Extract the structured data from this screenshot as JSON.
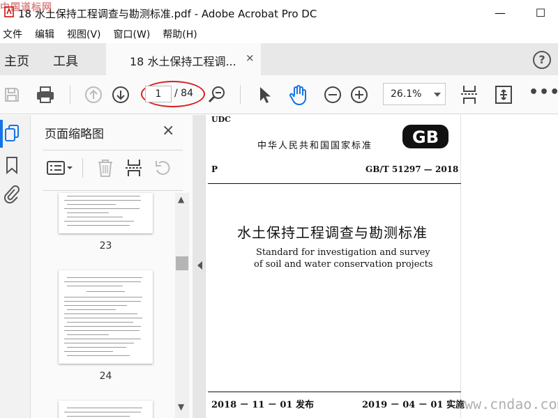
{
  "window": {
    "title": "18 水土保持工程调查与勘测标准.pdf - Adobe Acrobat Pro DC",
    "watermark_top": "中国道标网",
    "minimize_glyph": "—",
    "maximize_glyph": "☐"
  },
  "menu": [
    "文件",
    "编辑",
    "视图(V)",
    "窗口(W)",
    "帮助(H)"
  ],
  "tabs": {
    "home": "主页",
    "tools": "工具",
    "document": "18 水土保持工程调...",
    "close": "×",
    "help": "?"
  },
  "toolbar": {
    "icons": [
      "save-icon",
      "print-icon",
      "prev-page-icon",
      "next-page-icon",
      "zoom-search-icon",
      "select-arrow-icon",
      "hand-icon",
      "zoom-out-icon",
      "zoom-in-icon",
      "fit-width-icon",
      "fullscreen-icon",
      "more-icon"
    ],
    "page_current": "1",
    "page_total": "/ 84",
    "zoom": "26.1%",
    "more": "•••"
  },
  "navrail": {
    "icons": [
      "thumbnails-icon",
      "bookmark-icon",
      "attachment-icon"
    ],
    "accent": "#1473e6"
  },
  "thumbnail_panel": {
    "title": "页面缩略图",
    "close": "×",
    "tools": [
      "thumbnail-options-icon",
      "delete-page-icon",
      "extract-page-icon",
      "rotate-page-icon"
    ],
    "pages": [
      {
        "label": "23"
      },
      {
        "label": "24"
      }
    ]
  },
  "document": {
    "udc": "UDC",
    "national_standard": "中华人民共和国国家标准",
    "gb_logo": "GB",
    "p": "P",
    "code": "GB/T 51297 — 2018",
    "title_cn": "水土保持工程调查与勘测标准",
    "title_en_line1": "Standard for investigation and survey",
    "title_en_line2": "of soil and water conservation projects",
    "issue_date": "2018 － 11 － 01   发布",
    "impl_date": "2019 － 04 － 01   实施"
  },
  "watermark_bottom": "www.cndao.com",
  "colors": {
    "annotation_red": "#d62020",
    "accent_blue": "#1473e6"
  }
}
